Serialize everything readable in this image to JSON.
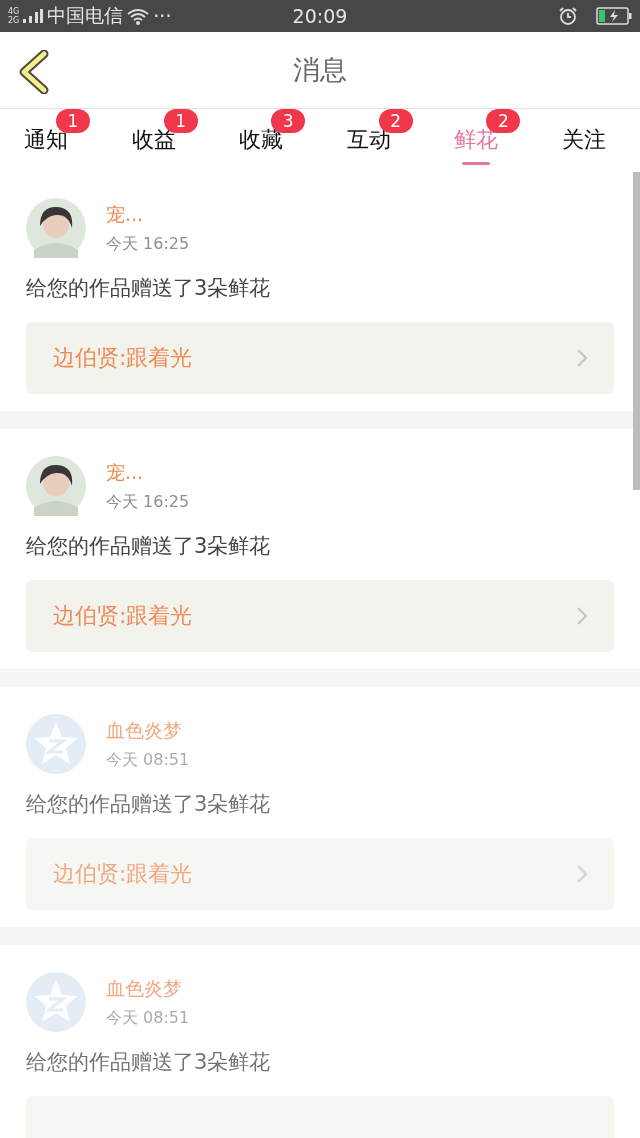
{
  "status_bar": {
    "network_top": "4G",
    "network_bottom": "2G",
    "carrier": "中国电信",
    "more": "···",
    "time": "20:09"
  },
  "header": {
    "title": "消息"
  },
  "tabs": [
    {
      "label": "通知",
      "badge": "1",
      "selected": false
    },
    {
      "label": "收益",
      "badge": "1",
      "selected": false
    },
    {
      "label": "收藏",
      "badge": "3",
      "selected": false
    },
    {
      "label": "互动",
      "badge": "2",
      "selected": false
    },
    {
      "label": "鲜花",
      "badge": "2",
      "selected": true
    },
    {
      "label": "关注",
      "selected": false
    }
  ],
  "messages": [
    {
      "avatar": {
        "kind": "photo"
      },
      "name": "宠...",
      "time": "今天 16:25",
      "text": "给您的作品赠送了3朵鲜花",
      "link": "边伯贤:跟着光",
      "read": false
    },
    {
      "avatar": {
        "kind": "photo"
      },
      "name": "宠...",
      "time": "今天 16:25",
      "text": "给您的作品赠送了3朵鲜花",
      "link": "边伯贤:跟着光",
      "read": false
    },
    {
      "avatar": {
        "kind": "default"
      },
      "name": "血色炎梦",
      "time": "今天 08:51",
      "text": "给您的作品赠送了3朵鲜花",
      "link": "边伯贤:跟着光",
      "read": true
    },
    {
      "avatar": {
        "kind": "default"
      },
      "name": "血色炎梦",
      "time": "今天 08:51",
      "text": "给您的作品赠送了3朵鲜花",
      "read": true
    }
  ]
}
